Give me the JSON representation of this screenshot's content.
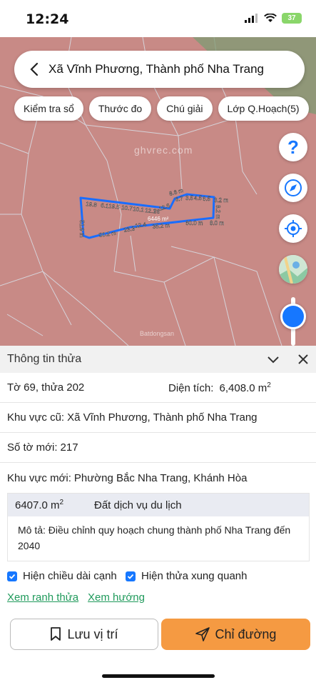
{
  "status": {
    "time": "12:24",
    "battery": "37"
  },
  "search": {
    "text": "Xã Vĩnh Phương, Thành phố Nha Trang"
  },
  "chips": [
    "Kiểm tra sổ",
    "Thước đo",
    "Chú giải",
    "Lớp Q.Hoạch(5)"
  ],
  "map": {
    "watermark": "ghvrec.com",
    "watermark_small": "Batdongsan",
    "area_label": "6446 m²",
    "edge_labels": [
      "19.8",
      "6.1",
      "19.5",
      "10.7",
      "10.1",
      "12.1",
      "26",
      "12.6",
      "6.7",
      "3.5",
      "4.5",
      "6.5",
      "3.2 m",
      "8.6 m",
      "8.2 m",
      "60.0 m",
      "35.2 m",
      "23.3",
      "12.4",
      "50.2 m",
      "51.9 m",
      "8.0 m"
    ]
  },
  "panel": {
    "title": "Thông tin thửa",
    "sheet_parcel": "Tờ 69, thửa 202",
    "area_label": "Diện tích:",
    "area_value": "6,408.0 m",
    "area_unit_sup": "2",
    "old_area_label": "Khu vực cũ:",
    "old_area_value": "Xã Vĩnh Phương, Thành phố Nha Trang",
    "new_sheet_label": "Số tờ mới:",
    "new_sheet_value": "217",
    "new_area_label": "Khu vực mới:",
    "new_area_value": "Phường Bắc Nha Trang, Khánh Hòa",
    "zone_area": "6407.0 m",
    "zone_area_sup": "2",
    "zone_type": "Đất dịch vụ du lịch",
    "zone_desc": "Mô tả: Điều chỉnh quy hoạch chung thành phố Nha Trang đến 2040"
  },
  "options": {
    "show_edges": "Hiện chiều dài cạnh",
    "show_neighbors": "Hiện thửa xung quanh"
  },
  "links": {
    "view_boundary": "Xem ranh thửa",
    "view_direction": "Xem hướng"
  },
  "buttons": {
    "save": "Lưu vị trí",
    "route": "Chỉ đường"
  },
  "colors": {
    "map_bg": "#c88a86",
    "parcel_line": "#1a6dff",
    "accent": "#1677ff",
    "route": "#f59a42",
    "link": "#1f9a5b"
  }
}
